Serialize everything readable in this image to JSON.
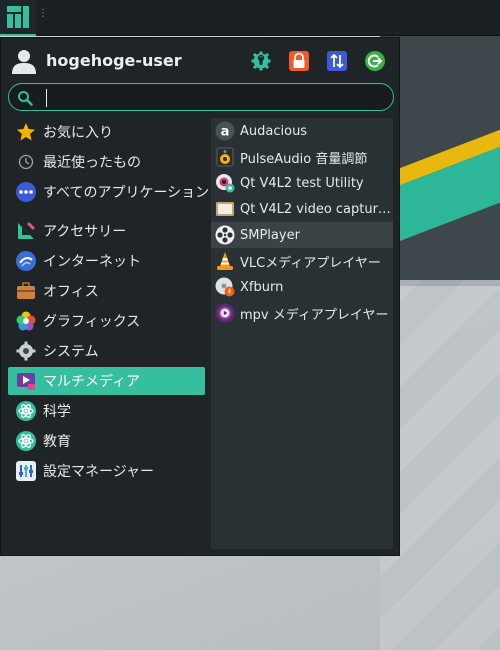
{
  "panel": {
    "launcher_icon": "manjaro-logo-icon",
    "handle_icon": "panel-handle-icon"
  },
  "user": {
    "name": "hogehoge-user",
    "avatar_icon": "user-avatar-icon"
  },
  "header_actions": [
    {
      "name": "settings-button",
      "icon": "settings-icon",
      "color": "#35bf9e"
    },
    {
      "name": "lock-button",
      "icon": "lock-icon",
      "color": "#f15a24"
    },
    {
      "name": "switch-user-button",
      "icon": "switch-user-icon",
      "color": "#3b5bdb"
    },
    {
      "name": "logout-button",
      "icon": "logout-icon",
      "color": "#3cb043"
    }
  ],
  "search": {
    "value": "",
    "placeholder": "",
    "icon": "search-icon"
  },
  "categories": [
    {
      "label": "お気に入り",
      "icon": "star-icon"
    },
    {
      "label": "最近使ったもの",
      "icon": "clock-icon"
    },
    {
      "label": "すべてのアプリケーション",
      "icon": "more-dots-icon"
    },
    {
      "label": "アクセサリー",
      "icon": "accessories-icon"
    },
    {
      "label": "インターネット",
      "icon": "internet-icon"
    },
    {
      "label": "オフィス",
      "icon": "briefcase-icon"
    },
    {
      "label": "グラフィックス",
      "icon": "graphics-icon"
    },
    {
      "label": "システム",
      "icon": "system-gear-icon"
    },
    {
      "label": "マルチメディア",
      "icon": "multimedia-icon",
      "selected": true
    },
    {
      "label": "科学",
      "icon": "science-icon"
    },
    {
      "label": "教育",
      "icon": "education-icon"
    },
    {
      "label": "設定マネージャー",
      "icon": "settings-manager-icon"
    }
  ],
  "apps": [
    {
      "label": "Audacious",
      "icon": "audacious-icon"
    },
    {
      "label": "PulseAudio 音量調節",
      "icon": "speaker-icon"
    },
    {
      "label": "Qt V4L2 test Utility",
      "icon": "webcam-icon"
    },
    {
      "label": "Qt V4L2 video capture…",
      "icon": "video-capture-icon"
    },
    {
      "label": "SMPlayer",
      "icon": "film-reel-icon",
      "hovered": true
    },
    {
      "label": "VLCメディアプレイヤー",
      "icon": "vlc-cone-icon"
    },
    {
      "label": "Xfburn",
      "icon": "disc-burn-icon"
    },
    {
      "label": "mpv メディアプレイヤー",
      "icon": "mpv-icon"
    }
  ],
  "colors": {
    "accent": "#35bf9e",
    "menu_bg": "#1f2426",
    "apps_bg": "#2a3134",
    "text": "#e6e9ea"
  }
}
